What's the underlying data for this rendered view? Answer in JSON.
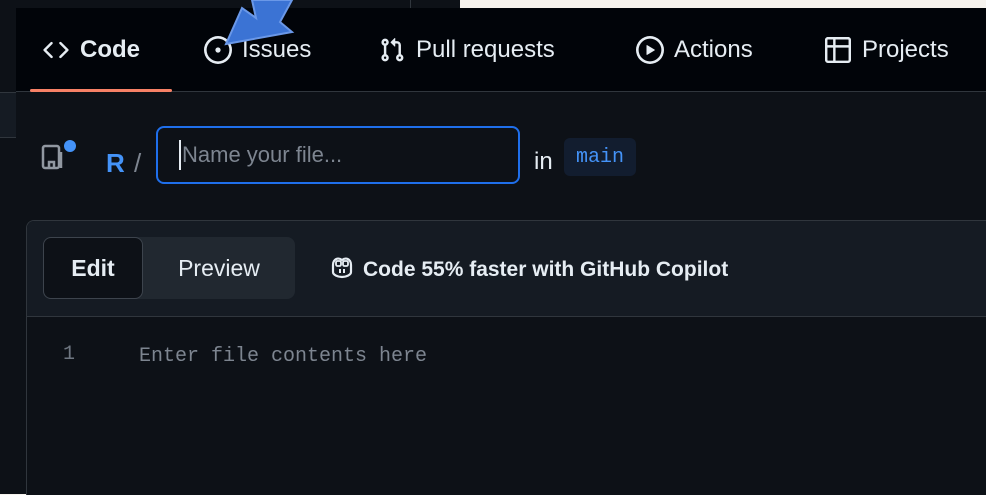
{
  "tabs": [
    {
      "label": "Code",
      "icon": "code-icon",
      "selected": true
    },
    {
      "label": "Issues",
      "icon": "issue-opened-icon"
    },
    {
      "label": "Pull requests",
      "icon": "git-pull-request-icon"
    },
    {
      "label": "Actions",
      "icon": "play-icon"
    },
    {
      "label": "Projects",
      "icon": "table-icon"
    }
  ],
  "editor": {
    "repo": "R",
    "separator": "/",
    "filename_placeholder": "Name your file...",
    "filename_value": "",
    "in_label": "in",
    "branch": "main"
  },
  "editor_panel": {
    "edit_label": "Edit",
    "preview_label": "Preview",
    "copilot_promo": "Code 55% faster with GitHub Copilot",
    "line_number": "1",
    "content_placeholder": "Enter file contents here"
  },
  "colors": {
    "accent": "#4493f8",
    "selected_tab_underline": "#f78166",
    "annotation_arrow": "#3b73d4"
  }
}
